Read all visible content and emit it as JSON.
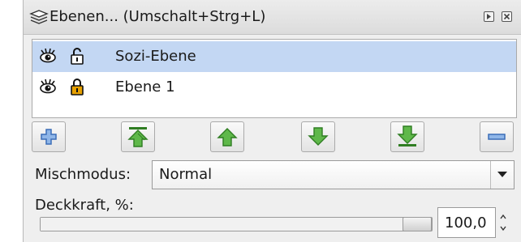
{
  "window": {
    "title": "Ebenen... (Umschalt+Strg+L)",
    "title_icon": "layers-icon",
    "controls": [
      "expand-icon",
      "close-icon"
    ]
  },
  "layers": [
    {
      "name": "Sozi-Ebene",
      "visible": true,
      "locked": false,
      "selected": true
    },
    {
      "name": "Ebene 1",
      "visible": true,
      "locked": true,
      "selected": false
    }
  ],
  "toolbar": {
    "buttons": [
      {
        "name": "add-layer-button",
        "icon": "plus-icon"
      },
      {
        "name": "raise-to-top-button",
        "icon": "arrow-top-icon"
      },
      {
        "name": "raise-button",
        "icon": "arrow-up-icon"
      },
      {
        "name": "lower-button",
        "icon": "arrow-down-icon"
      },
      {
        "name": "lower-to-bottom-button",
        "icon": "arrow-bottom-icon"
      },
      {
        "name": "remove-layer-button",
        "icon": "minus-icon"
      }
    ]
  },
  "blend": {
    "label": "Mischmodus:",
    "value": "Normal"
  },
  "opacity": {
    "label": "Deckkraft, %:",
    "value": "100,0",
    "fraction": 1.0
  },
  "colors": {
    "selection": "#c3d7f3",
    "arrow_green": "#3c9b2a",
    "plus_blue": "#3b6db7",
    "lock_gold": "#e6a000"
  }
}
